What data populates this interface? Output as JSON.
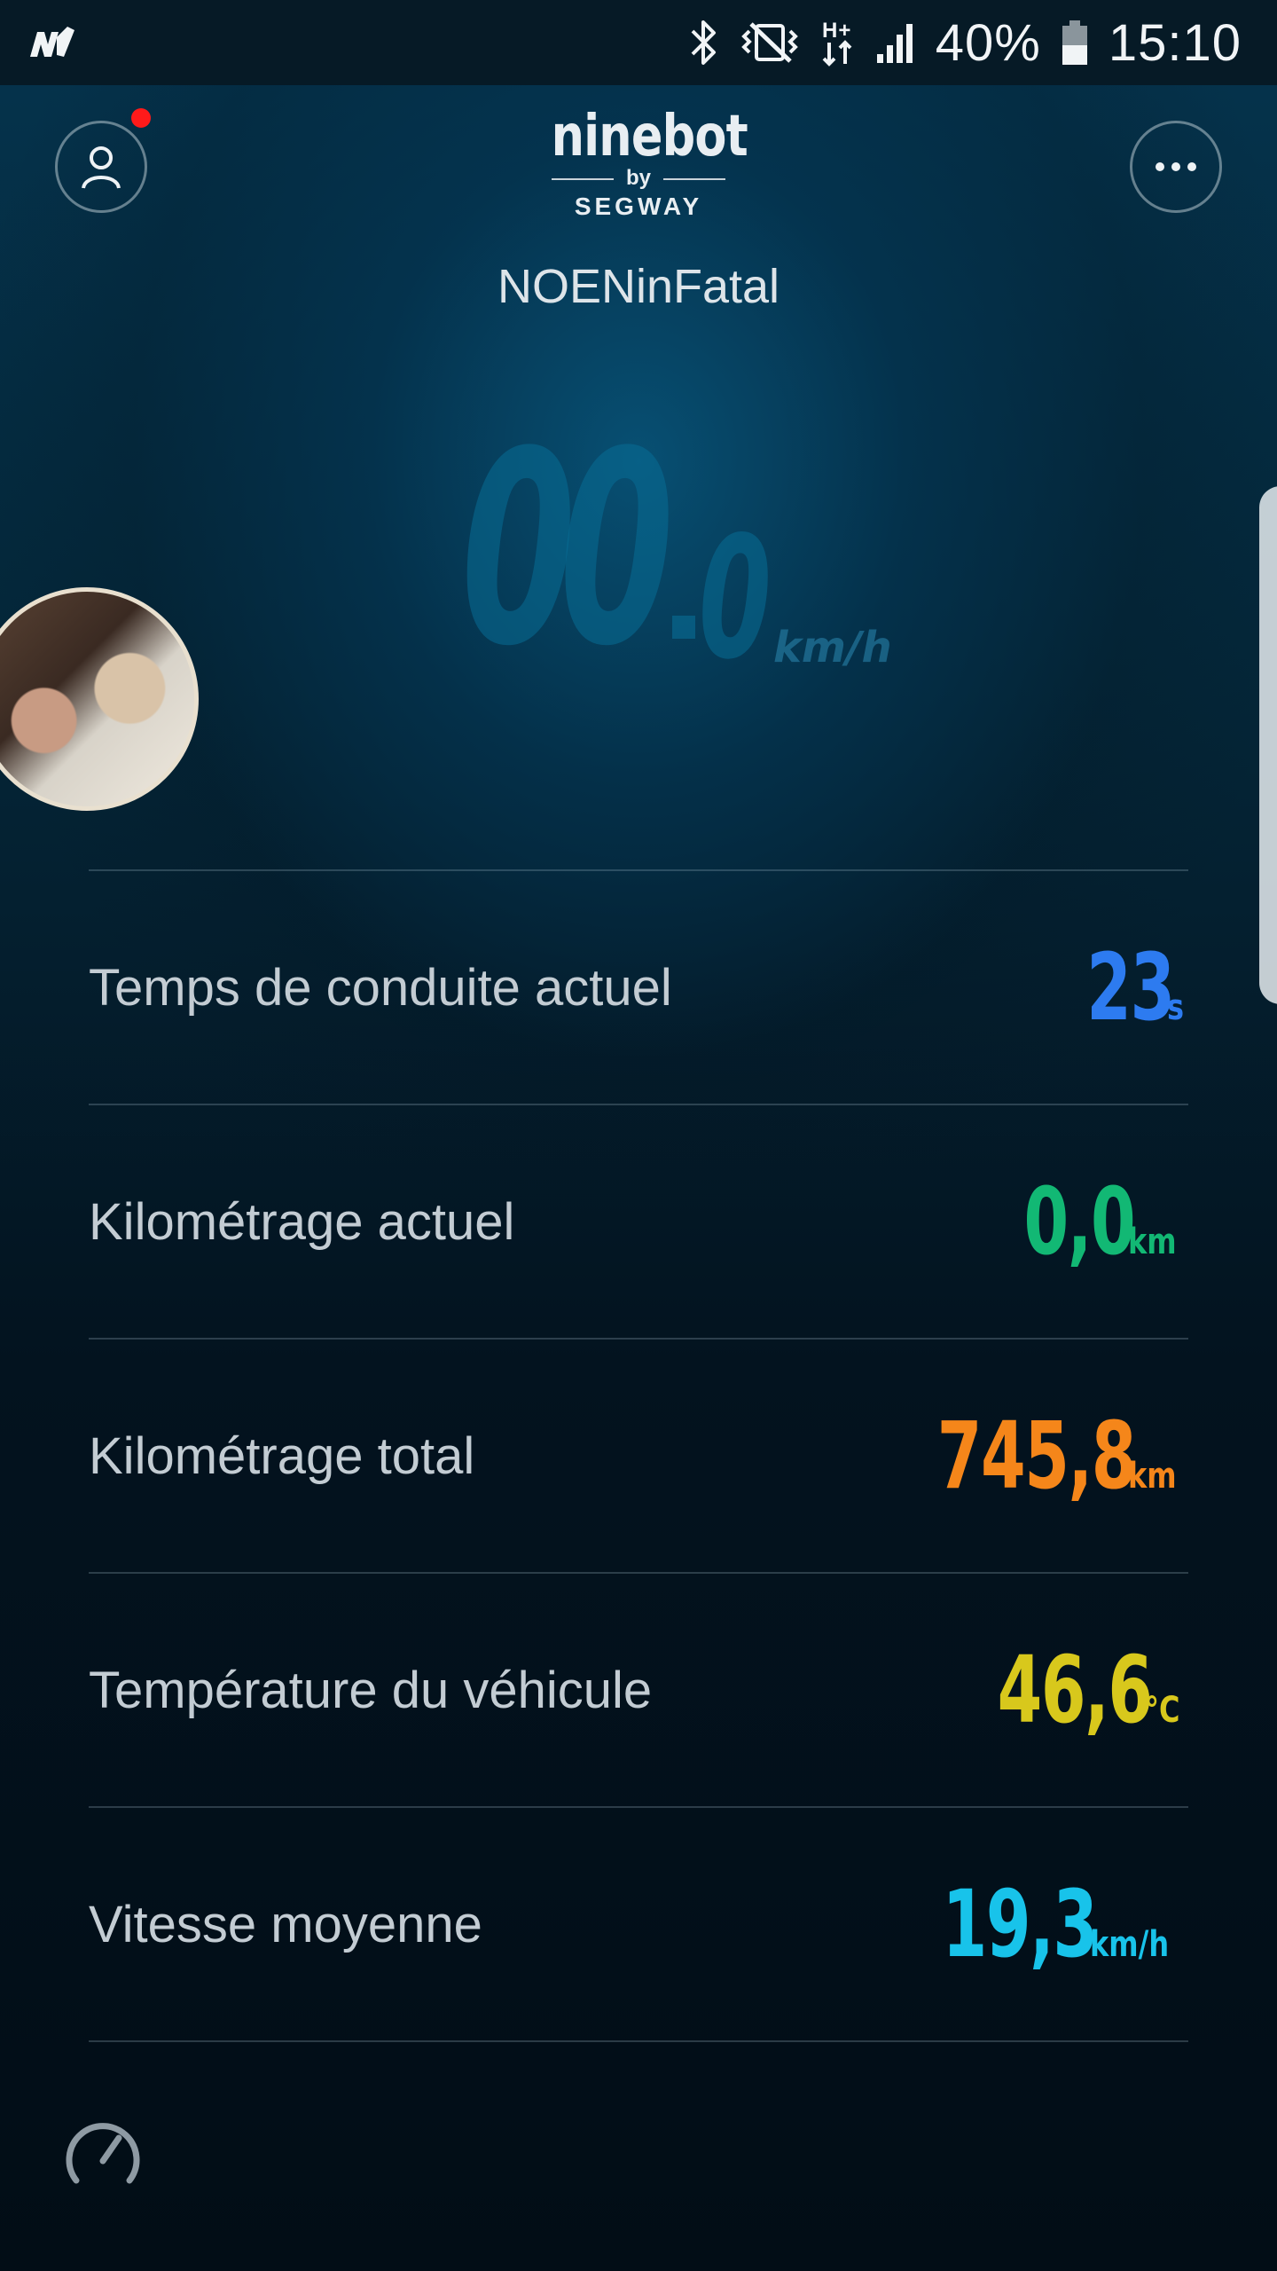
{
  "status_bar": {
    "app_icon": "nrj-radio-icon",
    "icons": [
      "bluetooth-icon",
      "vibrate-icon",
      "hplus-data-icon",
      "signal-icon",
      "battery-icon"
    ],
    "battery": "40%",
    "time": "15:10"
  },
  "header": {
    "logo": {
      "brand": "ninebot",
      "by": "by",
      "partner": "SEGWAY"
    },
    "device_name": "NOENinFatal",
    "profile_icon": "user-icon",
    "more_icon": "more-dots-icon",
    "notification": true
  },
  "speed": {
    "integer": "00",
    "decimal": "0",
    "unit": "km/h"
  },
  "stats": [
    {
      "label": "Temps de conduite actuel",
      "value": "23",
      "unit": "s",
      "color": "#2d7bf0"
    },
    {
      "label": "Kilométrage actuel",
      "value": "0,0",
      "unit": "km",
      "color": "#12b874"
    },
    {
      "label": "Kilométrage total",
      "value": "745,8",
      "unit": "km",
      "color": "#f5861a"
    },
    {
      "label": "Température du véhicule",
      "value": "46,6",
      "unit": "°C",
      "color": "#d8c81c"
    },
    {
      "label": "Vitesse moyenne",
      "value": "19,3",
      "unit": "km/h",
      "color": "#18c3ea"
    }
  ],
  "footer": {
    "icon": "speedometer-icon"
  },
  "colors": {
    "background_top": "#05344e",
    "background_bottom": "#020d16",
    "notification_dot": "#ff1a1a"
  }
}
